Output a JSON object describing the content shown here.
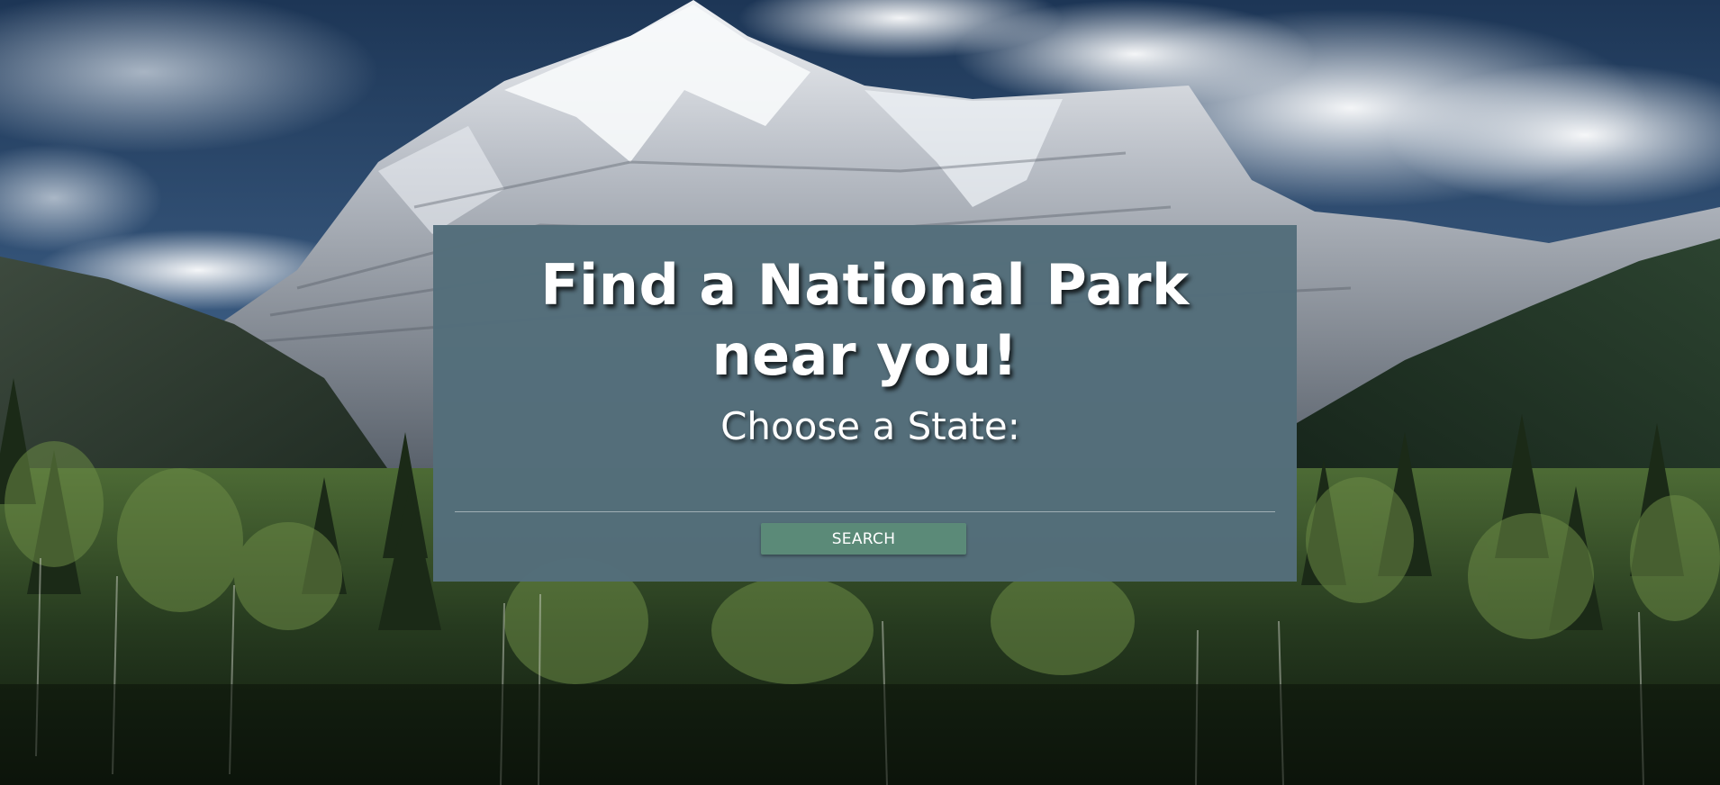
{
  "hero": {
    "title": "Find a National Park near you!",
    "state_label": "Choose a State:",
    "state_select": {
      "selected_value": ""
    },
    "search_button_label": "SEARCH"
  },
  "background": {
    "subject": "snow-capped mountain above a conifer forest under a cloudy blue sky"
  },
  "colors": {
    "panel": "#546e7a",
    "button": "#5b8a78",
    "text": "#ffffff"
  }
}
